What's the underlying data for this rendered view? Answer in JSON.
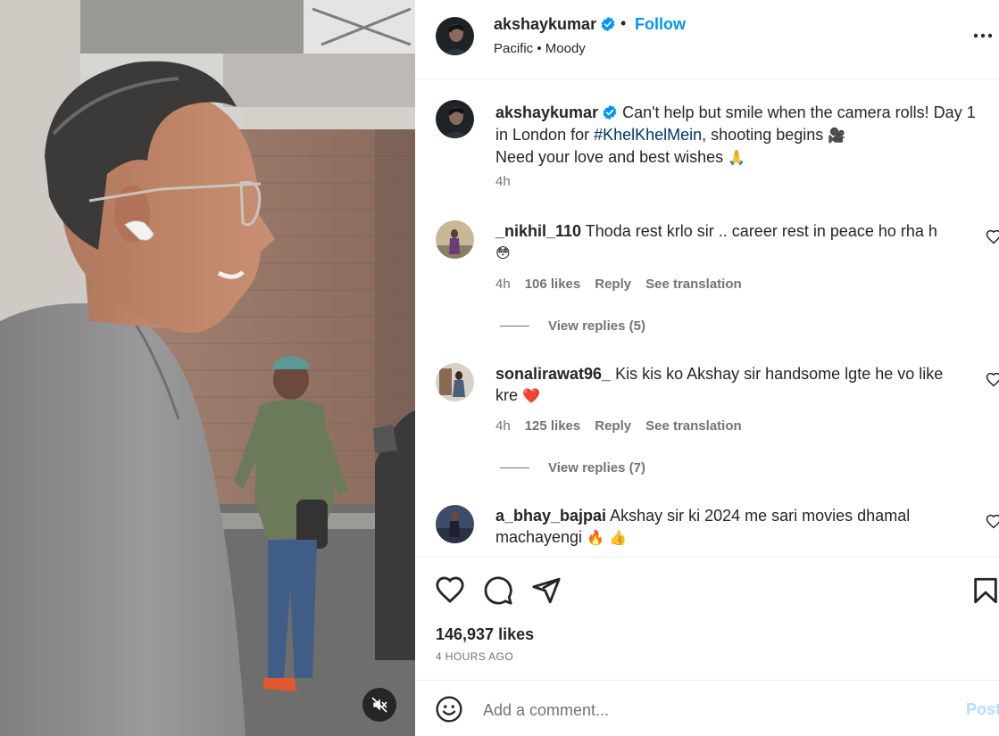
{
  "header": {
    "username": "akshaykumar",
    "dot": "•",
    "follow_label": "Follow",
    "subtitle": "Pacific • Moody"
  },
  "caption": {
    "username": "akshaykumar",
    "text_before": " Can't help but smile when the camera rolls! Day 1 in London for ",
    "hashtag": "#KhelKhelMein",
    "text_after": ", shooting begins ",
    "emoji1": "🎥",
    "line2": "Need your love and best wishes ",
    "emoji2": "🙏",
    "time": "4h"
  },
  "comments": [
    {
      "username": "_nikhil_110",
      "text": " Thoda rest krlo sir .. career rest in peace ho rha h",
      "emoji": "😳",
      "time": "4h",
      "likes": "106 likes",
      "reply_label": "Reply",
      "translation_label": "See translation",
      "view_replies": "View replies (5)"
    },
    {
      "username": "sonalirawat96_",
      "text": " Kis kis ko Akshay sir handsome lgte he vo like kre ",
      "emoji": "❤️",
      "time": "4h",
      "likes": "125 likes",
      "reply_label": "Reply",
      "translation_label": "See translation",
      "view_replies": "View replies (7)"
    },
    {
      "username": "a_bhay_bajpai",
      "text": " Akshay sir ki 2024 me sari movies dhamal machayengi ",
      "emoji": "🔥 👍"
    }
  ],
  "actions": {
    "likes": "146,937 likes",
    "time_ago": "4 HOURS AGO"
  },
  "comment_box": {
    "placeholder": "Add a comment...",
    "post_label": "Post"
  },
  "icons": {
    "verified": "verified-badge-icon",
    "more": "more-options-icon",
    "like": "heart-icon",
    "comment": "comment-bubble-icon",
    "share": "share-paper-plane-icon",
    "save": "bookmark-icon",
    "emoji": "emoji-smiley-icon",
    "mute": "muted-speaker-icon"
  },
  "colors": {
    "accent": "#0095f6",
    "hashtag": "#00376b",
    "secondary_text": "#737373",
    "post_disabled": "#b2dffc"
  }
}
